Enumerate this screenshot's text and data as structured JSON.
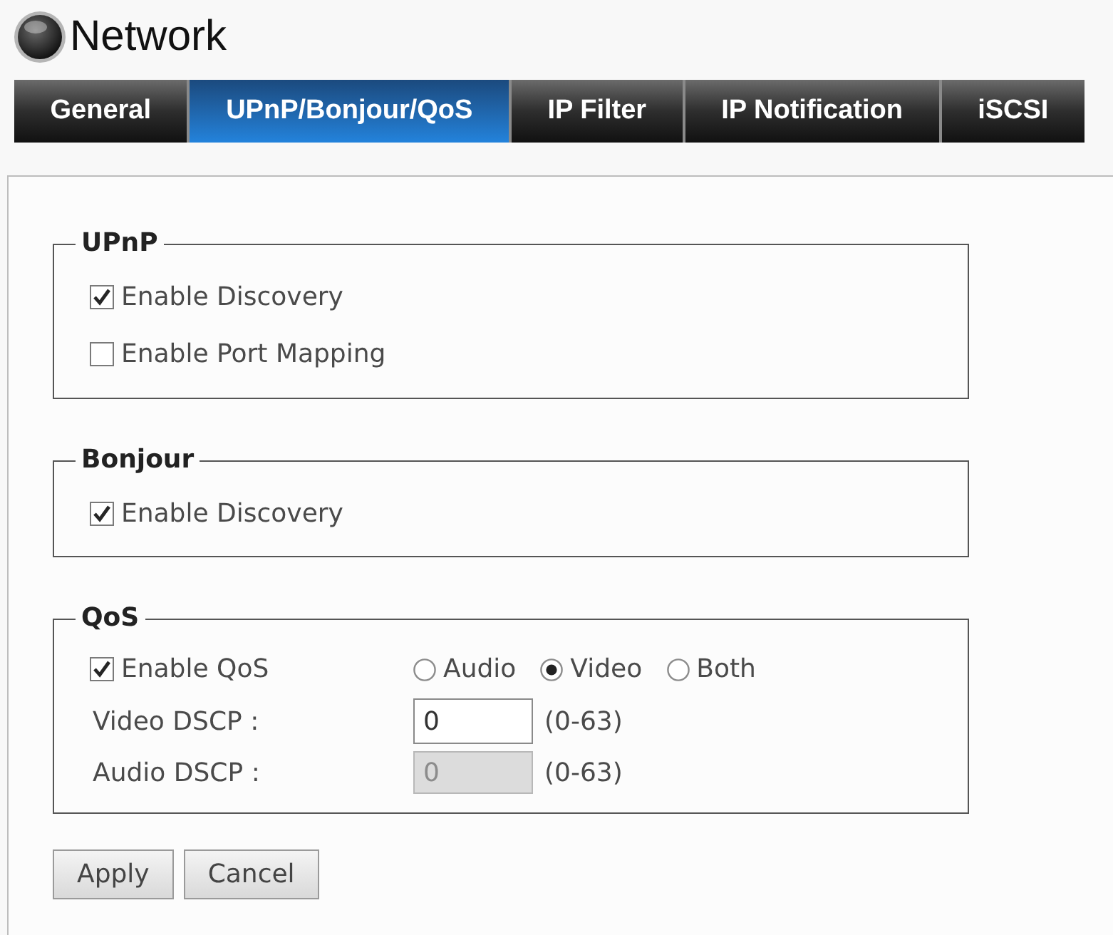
{
  "header": {
    "title": "Network"
  },
  "tabs": [
    {
      "label": "General",
      "selected": false
    },
    {
      "label": "UPnP/Bonjour/QoS",
      "selected": true
    },
    {
      "label": "IP Filter",
      "selected": false
    },
    {
      "label": "IP Notification",
      "selected": false
    },
    {
      "label": "iSCSI",
      "selected": false
    }
  ],
  "sections": [
    {
      "legend": "UPnP",
      "rows": [
        {
          "kind": "checkbox",
          "label": "Enable Discovery",
          "checked": true
        },
        {
          "kind": "checkbox",
          "label": "Enable Port Mapping",
          "checked": false
        }
      ]
    },
    {
      "legend": "Bonjour",
      "rows": [
        {
          "kind": "checkbox",
          "label": "Enable Discovery",
          "checked": true
        }
      ]
    },
    {
      "legend": "QoS",
      "rows": [
        {
          "kind": "checkbox_options",
          "label": "Enable QoS",
          "checked": true,
          "options": [
            {
              "label": "Audio",
              "selected": false
            },
            {
              "label": "Video",
              "selected": true
            },
            {
              "label": "Both",
              "selected": false
            }
          ]
        },
        {
          "kind": "number_field",
          "label": "Video DSCP :",
          "value": "0",
          "disabled": false,
          "hint": "(0-63)"
        },
        {
          "kind": "number_field",
          "label": "Audio DSCP :",
          "value": "0",
          "disabled": true,
          "hint": "(0-63)"
        }
      ]
    }
  ],
  "buttons": [
    "Apply",
    "Cancel"
  ]
}
